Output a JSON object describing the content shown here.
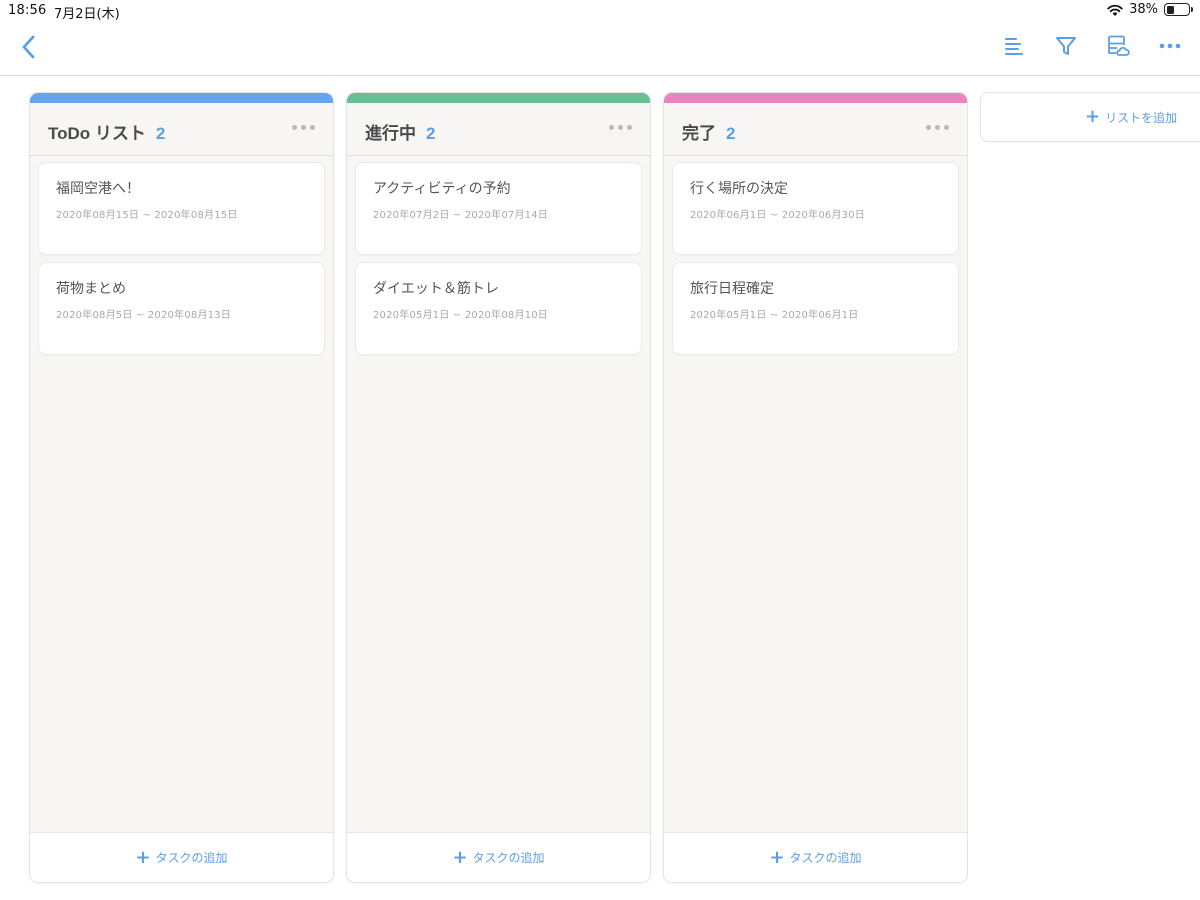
{
  "colors": {
    "accent": "#5c9ee6",
    "todo": "#66a4ef",
    "inprogress": "#66c094",
    "done": "#ea83bf"
  },
  "status": {
    "time": "18:56",
    "date": "7月2日(木)",
    "battery_percent": "38%",
    "battery_level": 0.38
  },
  "nav": {
    "back_icon": "chevron-left-icon",
    "icons": [
      "list-icon",
      "filter-icon",
      "cloud-storage-icon",
      "more-icon"
    ]
  },
  "columns": [
    {
      "title": "ToDo リスト",
      "count": "2",
      "add_label": "タスクの追加",
      "cards": [
        {
          "title": "福岡空港へ！",
          "date": "2020年08月15日 ~ 2020年08月15日"
        },
        {
          "title": "荷物まとめ",
          "date": "2020年08月5日 ~ 2020年08月13日"
        }
      ]
    },
    {
      "title": "進行中",
      "count": "2",
      "add_label": "タスクの追加",
      "cards": [
        {
          "title": "アクティビティの予約",
          "date": "2020年07月2日 ~ 2020年07月14日"
        },
        {
          "title": "ダイエット＆筋トレ",
          "date": "2020年05月1日 ~ 2020年08月10日"
        }
      ]
    },
    {
      "title": "完了",
      "count": "2",
      "add_label": "タスクの追加",
      "cards": [
        {
          "title": "行く場所の決定",
          "date": "2020年06月1日 ~ 2020年06月30日"
        },
        {
          "title": "旅行日程確定",
          "date": "2020年05月1日 ~ 2020年06月1日"
        }
      ]
    }
  ],
  "add_list_label": "リストを追加"
}
